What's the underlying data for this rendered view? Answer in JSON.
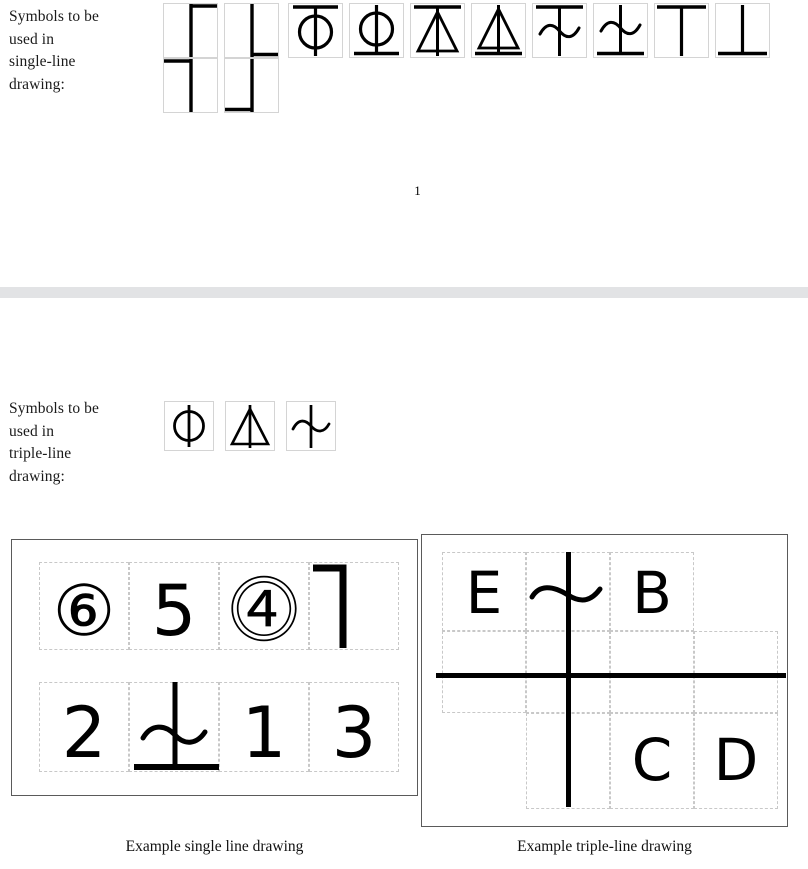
{
  "document": {
    "page_number": "1"
  },
  "section_single": {
    "label": "Symbols to be used in single-line drawing:",
    "label_lines": [
      "Symbols to be",
      "used in",
      "single-line",
      "drawing:"
    ],
    "symbols": [
      {
        "name": "vertical-line-top-right-bar",
        "glyph_type": "vbar-bar",
        "bar": "top",
        "bar_side": "right",
        "vline": true
      },
      {
        "name": "vertical-line-bottom-left-bar",
        "glyph_type": "vbar-bar",
        "bar": "bottom",
        "bar_side": "left",
        "vline": true
      },
      {
        "name": "vertical-line-top-bar",
        "glyph_type": "vbar-bar",
        "bar": "top",
        "bar_side": "full",
        "vline": true
      },
      {
        "name": "vertical-line-bottom-right-bar",
        "glyph_type": "vbar-bar",
        "bar": "bottom",
        "bar_side": "right",
        "vline": true
      },
      {
        "name": "circle-with-top-bar",
        "glyph_type": "circle",
        "bar": "top"
      },
      {
        "name": "circle-with-bottom-bar",
        "glyph_type": "circle",
        "bar": "bottom"
      },
      {
        "name": "triangle-with-top-bar",
        "glyph_type": "triangle",
        "bar": "top"
      },
      {
        "name": "triangle-with-bottom-bar",
        "glyph_type": "triangle",
        "bar": "bottom"
      },
      {
        "name": "sine-wave-with-top-bar",
        "glyph_type": "sine",
        "bar": "top"
      },
      {
        "name": "sine-wave-with-bottom-bar",
        "glyph_type": "sine",
        "bar": "bottom"
      },
      {
        "name": "tee-top-bar",
        "glyph_type": "plain",
        "bar": "top"
      },
      {
        "name": "tee-bottom-bar",
        "glyph_type": "plain",
        "bar": "bottom"
      }
    ]
  },
  "section_triple": {
    "label": "Symbols to be used in triple-line drawing:",
    "label_lines": [
      "Symbols to be",
      "used in",
      "triple-line",
      "drawing:"
    ],
    "symbols": [
      {
        "name": "circle-symbol",
        "glyph_type": "circle",
        "bar": "none"
      },
      {
        "name": "triangle-symbol",
        "glyph_type": "triangle",
        "bar": "none"
      },
      {
        "name": "sine-wave-symbol",
        "glyph_type": "sine",
        "bar": "none"
      }
    ]
  },
  "example_single": {
    "caption": "Example single line drawing",
    "cells": [
      {
        "name": "cell-circled-6",
        "text": "⑥",
        "kind": "text"
      },
      {
        "name": "cell-5",
        "text": "5",
        "kind": "text"
      },
      {
        "name": "cell-double-circled-4",
        "text": "⓸",
        "kind": "text"
      },
      {
        "name": "cell-corner-mark",
        "text": "",
        "kind": "corner"
      },
      {
        "name": "cell-2",
        "text": "2",
        "kind": "text"
      },
      {
        "name": "cell-sine-bottom-bar",
        "text": "",
        "kind": "sine-bottom"
      },
      {
        "name": "cell-1",
        "text": "1",
        "kind": "text"
      },
      {
        "name": "cell-3",
        "text": "3",
        "kind": "text"
      }
    ]
  },
  "example_triple": {
    "caption": "Example triple-line drawing",
    "cells": [
      {
        "name": "cell-E",
        "text": "E",
        "kind": "text"
      },
      {
        "name": "cell-sine-symbol",
        "text": "",
        "kind": "sine"
      },
      {
        "name": "cell-B",
        "text": "B",
        "kind": "text"
      },
      {
        "name": "cell-C",
        "text": "C",
        "kind": "text"
      },
      {
        "name": "cell-D",
        "text": "D",
        "kind": "text"
      }
    ]
  },
  "colors": {
    "ink": "#000000",
    "tile_border": "#d4d4d4",
    "frame_border": "#5a5a5a",
    "grid_dash": "#c8c8c8",
    "page_divider": "#e2e3e5"
  }
}
